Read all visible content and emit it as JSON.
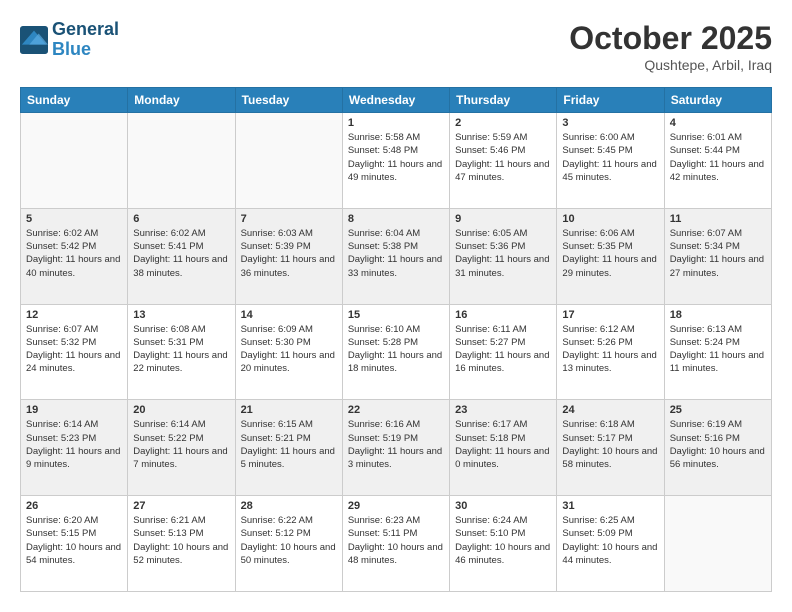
{
  "header": {
    "logo_line1": "General",
    "logo_line2": "Blue",
    "month_title": "October 2025",
    "location": "Qushtepe, Arbil, Iraq"
  },
  "weekdays": [
    "Sunday",
    "Monday",
    "Tuesday",
    "Wednesday",
    "Thursday",
    "Friday",
    "Saturday"
  ],
  "weeks": [
    [
      {
        "day": "",
        "sunrise": "",
        "sunset": "",
        "daylight": "",
        "empty": true
      },
      {
        "day": "",
        "sunrise": "",
        "sunset": "",
        "daylight": "",
        "empty": true
      },
      {
        "day": "",
        "sunrise": "",
        "sunset": "",
        "daylight": "",
        "empty": true
      },
      {
        "day": "1",
        "sunrise": "Sunrise: 5:58 AM",
        "sunset": "Sunset: 5:48 PM",
        "daylight": "Daylight: 11 hours and 49 minutes."
      },
      {
        "day": "2",
        "sunrise": "Sunrise: 5:59 AM",
        "sunset": "Sunset: 5:46 PM",
        "daylight": "Daylight: 11 hours and 47 minutes."
      },
      {
        "day": "3",
        "sunrise": "Sunrise: 6:00 AM",
        "sunset": "Sunset: 5:45 PM",
        "daylight": "Daylight: 11 hours and 45 minutes."
      },
      {
        "day": "4",
        "sunrise": "Sunrise: 6:01 AM",
        "sunset": "Sunset: 5:44 PM",
        "daylight": "Daylight: 11 hours and 42 minutes."
      }
    ],
    [
      {
        "day": "5",
        "sunrise": "Sunrise: 6:02 AM",
        "sunset": "Sunset: 5:42 PM",
        "daylight": "Daylight: 11 hours and 40 minutes."
      },
      {
        "day": "6",
        "sunrise": "Sunrise: 6:02 AM",
        "sunset": "Sunset: 5:41 PM",
        "daylight": "Daylight: 11 hours and 38 minutes."
      },
      {
        "day": "7",
        "sunrise": "Sunrise: 6:03 AM",
        "sunset": "Sunset: 5:39 PM",
        "daylight": "Daylight: 11 hours and 36 minutes."
      },
      {
        "day": "8",
        "sunrise": "Sunrise: 6:04 AM",
        "sunset": "Sunset: 5:38 PM",
        "daylight": "Daylight: 11 hours and 33 minutes."
      },
      {
        "day": "9",
        "sunrise": "Sunrise: 6:05 AM",
        "sunset": "Sunset: 5:36 PM",
        "daylight": "Daylight: 11 hours and 31 minutes."
      },
      {
        "day": "10",
        "sunrise": "Sunrise: 6:06 AM",
        "sunset": "Sunset: 5:35 PM",
        "daylight": "Daylight: 11 hours and 29 minutes."
      },
      {
        "day": "11",
        "sunrise": "Sunrise: 6:07 AM",
        "sunset": "Sunset: 5:34 PM",
        "daylight": "Daylight: 11 hours and 27 minutes."
      }
    ],
    [
      {
        "day": "12",
        "sunrise": "Sunrise: 6:07 AM",
        "sunset": "Sunset: 5:32 PM",
        "daylight": "Daylight: 11 hours and 24 minutes."
      },
      {
        "day": "13",
        "sunrise": "Sunrise: 6:08 AM",
        "sunset": "Sunset: 5:31 PM",
        "daylight": "Daylight: 11 hours and 22 minutes."
      },
      {
        "day": "14",
        "sunrise": "Sunrise: 6:09 AM",
        "sunset": "Sunset: 5:30 PM",
        "daylight": "Daylight: 11 hours and 20 minutes."
      },
      {
        "day": "15",
        "sunrise": "Sunrise: 6:10 AM",
        "sunset": "Sunset: 5:28 PM",
        "daylight": "Daylight: 11 hours and 18 minutes."
      },
      {
        "day": "16",
        "sunrise": "Sunrise: 6:11 AM",
        "sunset": "Sunset: 5:27 PM",
        "daylight": "Daylight: 11 hours and 16 minutes."
      },
      {
        "day": "17",
        "sunrise": "Sunrise: 6:12 AM",
        "sunset": "Sunset: 5:26 PM",
        "daylight": "Daylight: 11 hours and 13 minutes."
      },
      {
        "day": "18",
        "sunrise": "Sunrise: 6:13 AM",
        "sunset": "Sunset: 5:24 PM",
        "daylight": "Daylight: 11 hours and 11 minutes."
      }
    ],
    [
      {
        "day": "19",
        "sunrise": "Sunrise: 6:14 AM",
        "sunset": "Sunset: 5:23 PM",
        "daylight": "Daylight: 11 hours and 9 minutes."
      },
      {
        "day": "20",
        "sunrise": "Sunrise: 6:14 AM",
        "sunset": "Sunset: 5:22 PM",
        "daylight": "Daylight: 11 hours and 7 minutes."
      },
      {
        "day": "21",
        "sunrise": "Sunrise: 6:15 AM",
        "sunset": "Sunset: 5:21 PM",
        "daylight": "Daylight: 11 hours and 5 minutes."
      },
      {
        "day": "22",
        "sunrise": "Sunrise: 6:16 AM",
        "sunset": "Sunset: 5:19 PM",
        "daylight": "Daylight: 11 hours and 3 minutes."
      },
      {
        "day": "23",
        "sunrise": "Sunrise: 6:17 AM",
        "sunset": "Sunset: 5:18 PM",
        "daylight": "Daylight: 11 hours and 0 minutes."
      },
      {
        "day": "24",
        "sunrise": "Sunrise: 6:18 AM",
        "sunset": "Sunset: 5:17 PM",
        "daylight": "Daylight: 10 hours and 58 minutes."
      },
      {
        "day": "25",
        "sunrise": "Sunrise: 6:19 AM",
        "sunset": "Sunset: 5:16 PM",
        "daylight": "Daylight: 10 hours and 56 minutes."
      }
    ],
    [
      {
        "day": "26",
        "sunrise": "Sunrise: 6:20 AM",
        "sunset": "Sunset: 5:15 PM",
        "daylight": "Daylight: 10 hours and 54 minutes."
      },
      {
        "day": "27",
        "sunrise": "Sunrise: 6:21 AM",
        "sunset": "Sunset: 5:13 PM",
        "daylight": "Daylight: 10 hours and 52 minutes."
      },
      {
        "day": "28",
        "sunrise": "Sunrise: 6:22 AM",
        "sunset": "Sunset: 5:12 PM",
        "daylight": "Daylight: 10 hours and 50 minutes."
      },
      {
        "day": "29",
        "sunrise": "Sunrise: 6:23 AM",
        "sunset": "Sunset: 5:11 PM",
        "daylight": "Daylight: 10 hours and 48 minutes."
      },
      {
        "day": "30",
        "sunrise": "Sunrise: 6:24 AM",
        "sunset": "Sunset: 5:10 PM",
        "daylight": "Daylight: 10 hours and 46 minutes."
      },
      {
        "day": "31",
        "sunrise": "Sunrise: 6:25 AM",
        "sunset": "Sunset: 5:09 PM",
        "daylight": "Daylight: 10 hours and 44 minutes."
      },
      {
        "day": "",
        "sunrise": "",
        "sunset": "",
        "daylight": "",
        "empty": true
      }
    ]
  ]
}
